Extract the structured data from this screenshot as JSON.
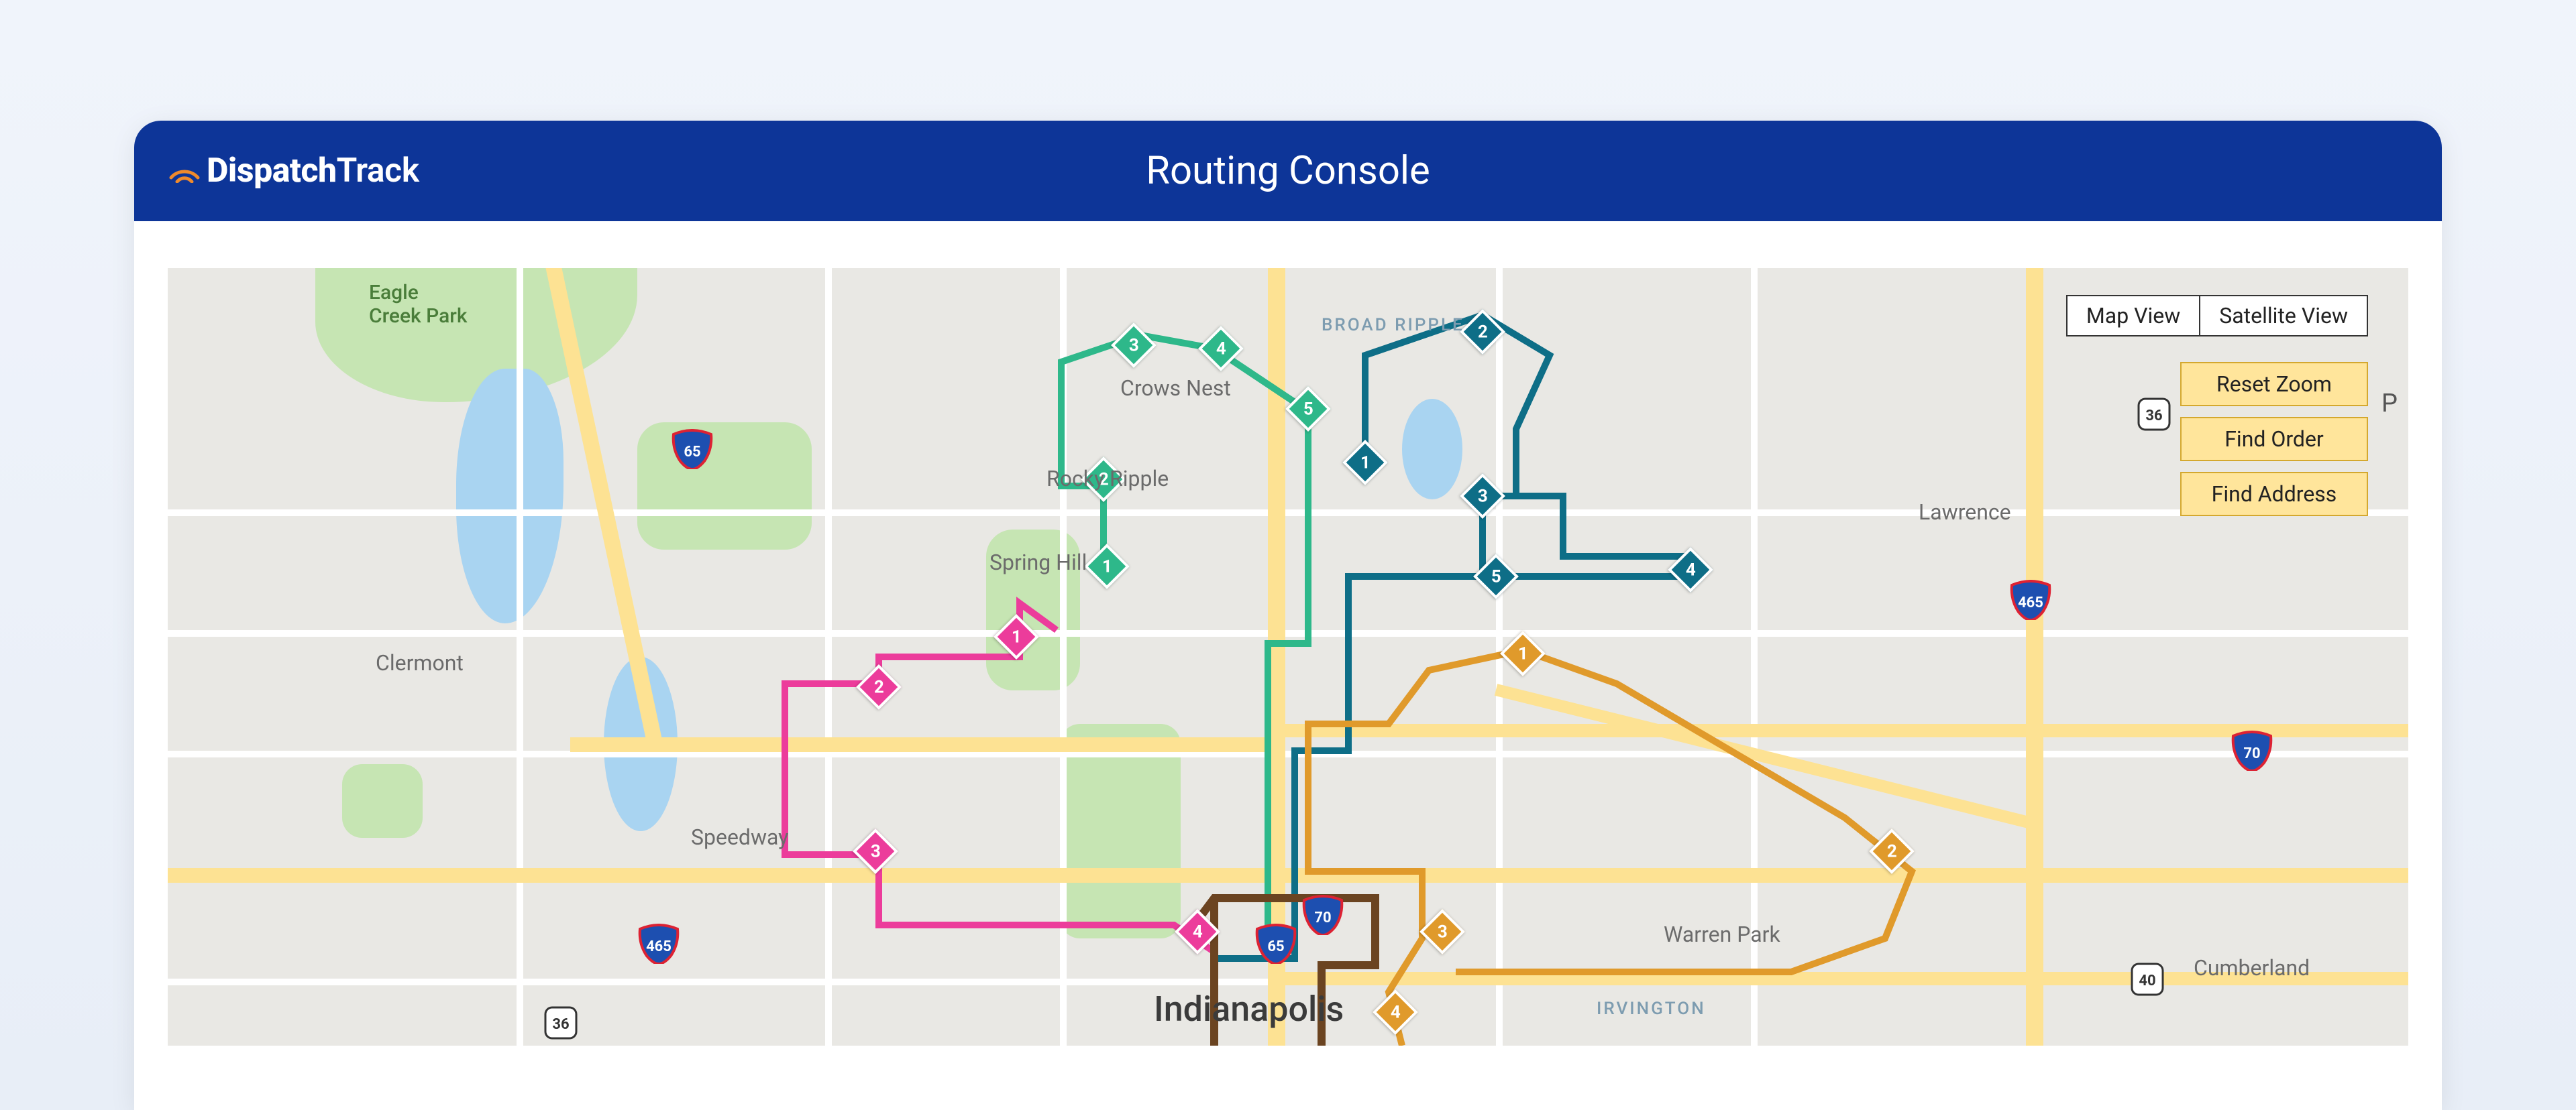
{
  "header": {
    "logo_text_1": "Dispatch",
    "logo_text_2": "Track",
    "title": "Routing Console"
  },
  "controls": {
    "view_map": "Map View",
    "view_satellite": "Satellite View",
    "reset_zoom": "Reset Zoom",
    "find_order": "Find Order",
    "find_address": "Find Address"
  },
  "map": {
    "city": "Indianapolis",
    "labels": {
      "eagle_creek": "Eagle\nCreek Park",
      "crows_nest": "Crows Nest",
      "broad_ripple": "BROAD RIPPLE",
      "rocky_ripple": "Rocky Ripple",
      "spring_hill": "Spring Hill",
      "clermont": "Clermont",
      "speedway": "Speedway",
      "lawrence": "Lawrence",
      "warren_park": "Warren Park",
      "cumberland": "Cumberland",
      "irvington": "IRVINGTON",
      "p_fragment": "P"
    },
    "shields": {
      "i65_nw": "65",
      "i465_w": "465",
      "i465_e": "465",
      "i70_e": "70",
      "i70_c": "70",
      "i65_c": "65",
      "us36_w": "36",
      "us36_ne": "36",
      "us40_e": "40"
    },
    "routes": {
      "green": {
        "color": "#2eb88a",
        "stops": [
          "1",
          "2",
          "3",
          "4",
          "5"
        ]
      },
      "teal": {
        "color": "#0e6e87",
        "stops": [
          "1",
          "2",
          "3",
          "4",
          "5"
        ]
      },
      "pink": {
        "color": "#ec3c9b",
        "stops": [
          "1",
          "2",
          "3",
          "4"
        ]
      },
      "orange": {
        "color": "#e09a2b",
        "stops": [
          "1",
          "2",
          "3",
          "4"
        ]
      },
      "brown": {
        "color": "#6b4421"
      }
    }
  }
}
